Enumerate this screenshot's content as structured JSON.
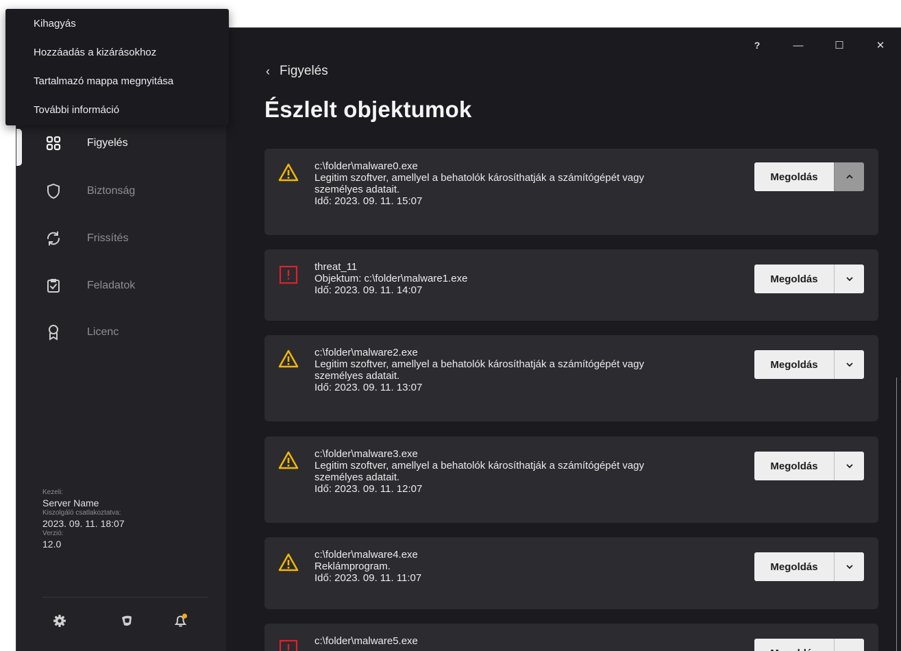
{
  "context_menu": {
    "items": [
      {
        "label": "Kihagyás"
      },
      {
        "label": "Hozzáadás a kizárásokhoz"
      },
      {
        "label": "Tartalmazó mappa megnyitása"
      },
      {
        "label": "További információ"
      }
    ]
  },
  "window_controls": {
    "help": "?",
    "minimize": "—",
    "maximize": "☐",
    "close": "✕"
  },
  "sidebar": {
    "nav": [
      {
        "label": "Figyelés",
        "icon": "dashboard-icon",
        "active": true
      },
      {
        "label": "Biztonság",
        "icon": "shield-icon",
        "active": false
      },
      {
        "label": "Frissítés",
        "icon": "refresh-icon",
        "active": false
      },
      {
        "label": "Feladatok",
        "icon": "clipboard-check-icon",
        "active": false
      },
      {
        "label": "Licenc",
        "icon": "award-icon",
        "active": false
      }
    ],
    "info": {
      "managed_by_label": "Kezeli:",
      "managed_by_value": "Server Name",
      "connected_label": "Kiszolgáló csatlakoztatva:",
      "connected_value": "2023. 09. 11. 18:07",
      "version_label": "Verzió:",
      "version_value": "12.0"
    },
    "bottom_icons": [
      "gear-icon",
      "kaspersky-logo-icon",
      "notification-bell-icon"
    ]
  },
  "main": {
    "back_label": "Figyelés",
    "title": "Észlelt objektumok",
    "resolve_label": "Megoldás",
    "cards": [
      {
        "icon": "warning-icon",
        "lines": [
          "c:\\folder\\malware0.exe",
          "Legitim szoftver, amellyel a behatolók károsíthatják a számítógépét vagy",
          "személyes adatait.",
          "Idő: 2023. 09. 11. 15:07"
        ],
        "expanded": true
      },
      {
        "icon": "threat-icon",
        "lines": [
          "threat_11",
          "Objektum: c:\\folder\\malware1.exe",
          "Idő: 2023. 09. 11. 14:07"
        ],
        "expanded": false
      },
      {
        "icon": "warning-icon",
        "lines": [
          "c:\\folder\\malware2.exe",
          "Legitim szoftver, amellyel a behatolók károsíthatják a számítógépét vagy",
          "személyes adatait.",
          "Idő: 2023. 09. 11. 13:07"
        ],
        "expanded": false
      },
      {
        "icon": "warning-icon",
        "lines": [
          "c:\\folder\\malware3.exe",
          "Legitim szoftver, amellyel a behatolók károsíthatják a számítógépét vagy",
          "személyes adatait.",
          "Idő: 2023. 09. 11. 12:07"
        ],
        "expanded": false
      },
      {
        "icon": "warning-icon",
        "lines": [
          "c:\\folder\\malware4.exe",
          "Reklámprogram.",
          "Idő: 2023. 09. 11. 11:07"
        ],
        "expanded": false
      },
      {
        "icon": "threat-icon",
        "lines": [
          "c:\\folder\\malware5.exe"
        ],
        "expanded": false
      }
    ]
  },
  "colors": {
    "warning": "#f5b800",
    "threat": "#e0202a",
    "accent_badge": "#f5a623"
  }
}
